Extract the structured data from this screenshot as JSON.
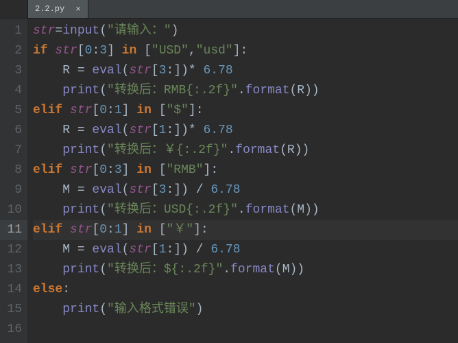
{
  "tab": {
    "name": "2.2.py",
    "close": "×"
  },
  "gutter": [
    "1",
    "2",
    "3",
    "4",
    "5",
    "6",
    "7",
    "8",
    "9",
    "10",
    "11",
    "12",
    "13",
    "14",
    "15",
    "16"
  ],
  "highlight_line": 11,
  "code": {
    "l1": {
      "a": "str",
      "b": "=",
      "c": "input",
      "d": "(",
      "e": "\"请输入：\"",
      "f": ")"
    },
    "l2": {
      "a": "if ",
      "b": "str",
      "c": "[",
      "d": "0",
      "e": ":",
      "f": "3",
      "g": "] ",
      "h": "in ",
      "i": "[",
      "j": "\"USD\"",
      "k": ",",
      "l": "\"usd\"",
      "m": "]:"
    },
    "l3": {
      "a": "    R ",
      "b": "= ",
      "c": "eval",
      "d": "(",
      "e": "str",
      "f": "[",
      "g": "3",
      "h": ":])",
      "i": "* ",
      "j": "6.78"
    },
    "l4": {
      "a": "    ",
      "b": "print",
      "c": "(",
      "d": "\"转换后：RMB{:.2f}\"",
      "e": ".",
      "f": "format",
      "g": "(R))"
    },
    "l5": {
      "a": "elif ",
      "b": "str",
      "c": "[",
      "d": "0",
      "e": ":",
      "f": "1",
      "g": "] ",
      "h": "in ",
      "i": "[",
      "j": "\"$\"",
      "k": "]:"
    },
    "l6": {
      "a": "    R ",
      "b": "= ",
      "c": "eval",
      "d": "(",
      "e": "str",
      "f": "[",
      "g": "1",
      "h": ":])",
      "i": "* ",
      "j": "6.78"
    },
    "l7": {
      "a": "    ",
      "b": "print",
      "c": "(",
      "d": "\"转换后：￥{:.2f}\"",
      "e": ".",
      "f": "format",
      "g": "(R))"
    },
    "l8": {
      "a": "elif ",
      "b": "str",
      "c": "[",
      "d": "0",
      "e": ":",
      "f": "3",
      "g": "] ",
      "h": "in ",
      "i": "[",
      "j": "\"RMB\"",
      "k": "]:"
    },
    "l9": {
      "a": "    M ",
      "b": "= ",
      "c": "eval",
      "d": "(",
      "e": "str",
      "f": "[",
      "g": "3",
      "h": ":]) ",
      "i": "/ ",
      "j": "6.78"
    },
    "l10": {
      "a": "    ",
      "b": "print",
      "c": "(",
      "d": "\"转换后：USD{:.2f}\"",
      "e": ".",
      "f": "format",
      "g": "(M))"
    },
    "l11": {
      "a": "elif ",
      "b": "str",
      "c": "[",
      "d": "0",
      "e": ":",
      "f": "1",
      "g": "] ",
      "h": "in ",
      "i": "[",
      "j": "\"￥\"",
      "k": "]:"
    },
    "l12": {
      "a": "    M ",
      "b": "= ",
      "c": "eval",
      "d": "(",
      "e": "str",
      "f": "[",
      "g": "1",
      "h": ":]) ",
      "i": "/ ",
      "j": "6.78"
    },
    "l13": {
      "a": "    ",
      "b": "print",
      "c": "(",
      "d": "\"转换后：${:.2f}\"",
      "e": ".",
      "f": "format",
      "g": "(M))"
    },
    "l14": {
      "a": "else",
      "b": ":"
    },
    "l15": {
      "a": "    ",
      "b": "print",
      "c": "(",
      "d": "\"输入格式错误\"",
      "e": ")"
    }
  }
}
